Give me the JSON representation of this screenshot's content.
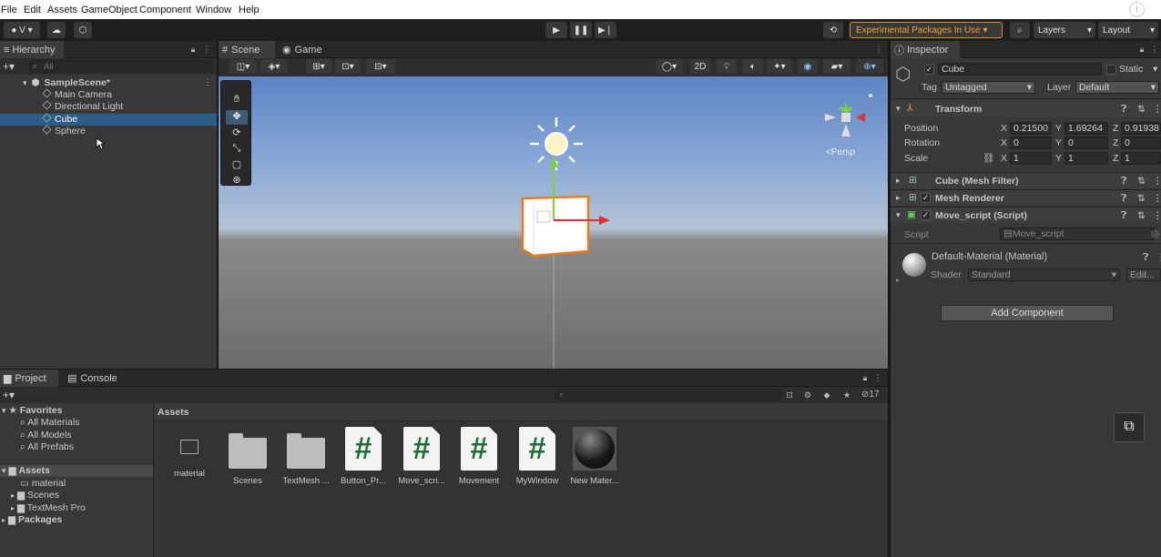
{
  "menu": [
    "File",
    "Edit",
    "Assets",
    "GameObject",
    "Component",
    "Window",
    "Help"
  ],
  "toolbar": {
    "account_label": "V",
    "experimental_label": "Experimental Packages In Use",
    "layers_label": "Layers",
    "layout_label": "Layout"
  },
  "hierarchy": {
    "tab": "Hierarchy",
    "search_placeholder": "All",
    "scene": "SampleScene*",
    "items": [
      "Main Camera",
      "Directional Light",
      "Cube",
      "Sphere"
    ]
  },
  "scene_tabs": {
    "scene": "Scene",
    "game": "Game"
  },
  "scene_view": {
    "mode_2d": "2D",
    "persp_label": "<Persp"
  },
  "inspector": {
    "tab": "Inspector",
    "object_name": "Cube",
    "static_label": "Static",
    "tag_label": "Tag",
    "tag_value": "Untagged",
    "layer_label": "Layer",
    "layer_value": "Default",
    "transform": {
      "title": "Transform",
      "position": {
        "label": "Position",
        "x": "0.21500",
        "y": "1.69264",
        "z": "0.91938"
      },
      "rotation": {
        "label": "Rotation",
        "x": "0",
        "y": "0",
        "z": "0"
      },
      "scale": {
        "label": "Scale",
        "x": "1",
        "y": "1",
        "z": "1"
      }
    },
    "axis": {
      "x": "X",
      "y": "Y",
      "z": "Z"
    },
    "mesh_filter": "Cube (Mesh Filter)",
    "mesh_renderer": "Mesh Renderer",
    "move_script": "Move_script (Script)",
    "script_label": "Script",
    "script_value": "Move_script",
    "material": "Default-Material (Material)",
    "shader_label": "Shader",
    "shader_value": "Standard",
    "edit_label": "Edit...",
    "add_component": "Add Component"
  },
  "project": {
    "tab_project": "Project",
    "tab_console": "Console",
    "hidden_count": "17",
    "favorites": "Favorites",
    "fav_items": [
      "All Materials",
      "All Models",
      "All Prefabs"
    ],
    "assets_root": "Assets",
    "asset_tree": [
      "material",
      "Scenes",
      "TextMesh Pro"
    ],
    "packages": "Packages",
    "breadcrumb": "Assets",
    "assets": [
      {
        "name": "material",
        "kind": "folder-empty"
      },
      {
        "name": "Scenes",
        "kind": "folder"
      },
      {
        "name": "TextMesh ...",
        "kind": "folder"
      },
      {
        "name": "Button_Pr...",
        "kind": "script"
      },
      {
        "name": "Move_scri...",
        "kind": "script"
      },
      {
        "name": "Movement",
        "kind": "script"
      },
      {
        "name": "MyWindow",
        "kind": "script"
      },
      {
        "name": "New Mater...",
        "kind": "material"
      }
    ]
  },
  "colors": {
    "selection": "#2c5d87",
    "script_hash": "#1f6e36",
    "cube_outline": "#f07a1a",
    "experimental": "#f0a030"
  }
}
